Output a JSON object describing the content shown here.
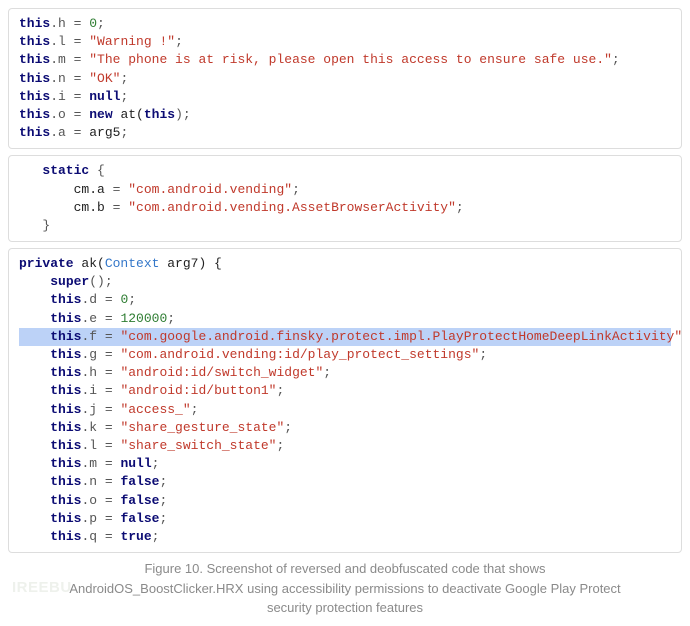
{
  "block1": {
    "l0_pre": "this",
    "l0_field": ".h = ",
    "l0_val": "0",
    "l1_pre": "this",
    "l1_field": ".l = ",
    "l1_val": "\"Warning !\"",
    "l2_pre": "this",
    "l2_field": ".m = ",
    "l2_val": "\"The phone is at risk, please open this access to ensure safe use.\"",
    "l3_pre": "this",
    "l3_field": ".n = ",
    "l3_val": "\"OK\"",
    "l4_pre": "this",
    "l4_field": ".i = ",
    "l4_val": "null",
    "l5_pre": "this",
    "l5_field": ".o = ",
    "l5_new": "new ",
    "l5_call": "at(",
    "l5_arg": "this",
    "l5_end": ")",
    "l6_pre": "this",
    "l6_field": ".a = ",
    "l6_val": "arg5"
  },
  "block2": {
    "l0_kw": "static",
    "l0_brace": " {",
    "l1_id": "cm.a",
    "l1_eq": " = ",
    "l1_val": "\"com.android.vending\"",
    "l2_id": "cm.b",
    "l2_eq": " = ",
    "l2_val": "\"com.android.vending.AssetBrowserActivity\"",
    "l3_brace": "}"
  },
  "block3": {
    "l0_kw": "private",
    "l0_name": " ak(",
    "l0_type": "Context",
    "l0_arg": " arg7) {",
    "l1_super": "super",
    "l1_paren": "();",
    "l2_pre": "this",
    "l2_field": ".d = ",
    "l2_val": "0",
    "l3_pre": "this",
    "l3_field": ".e = ",
    "l3_val": "120000",
    "l4_pre": "this",
    "l4_field": ".f = ",
    "l4_val": "\"com.google.android.finsky.protect.impl.PlayProtectHomeDeepLinkActivity\"",
    "l5_pre": "this",
    "l5_field": ".g = ",
    "l5_val": "\"com.android.vending:id/play_protect_settings\"",
    "l6_pre": "this",
    "l6_field": ".h = ",
    "l6_val": "\"android:id/switch_widget\"",
    "l7_pre": "this",
    "l7_field": ".i = ",
    "l7_val": "\"android:id/button1\"",
    "l8_pre": "this",
    "l8_field": ".j = ",
    "l8_val": "\"access_\"",
    "l9_pre": "this",
    "l9_field": ".k = ",
    "l9_val": "\"share_gesture_state\"",
    "l10_pre": "this",
    "l10_field": ".l = ",
    "l10_val": "\"share_switch_state\"",
    "l11_pre": "this",
    "l11_field": ".m = ",
    "l11_val": "null",
    "l12_pre": "this",
    "l12_field": ".n = ",
    "l12_val": "false",
    "l13_pre": "this",
    "l13_field": ".o = ",
    "l13_val": "false",
    "l14_pre": "this",
    "l14_field": ".p = ",
    "l14_val": "false",
    "l15_pre": "this",
    "l15_field": ".q = ",
    "l15_val": "true"
  },
  "caption": {
    "line1": "Figure 10. Screenshot of reversed and deobfuscated code that shows",
    "line2": "AndroidOS_BoostClicker.HRX using accessibility permissions to deactivate Google Play Protect",
    "line3": "security protection features"
  },
  "watermark": "IREEBU"
}
